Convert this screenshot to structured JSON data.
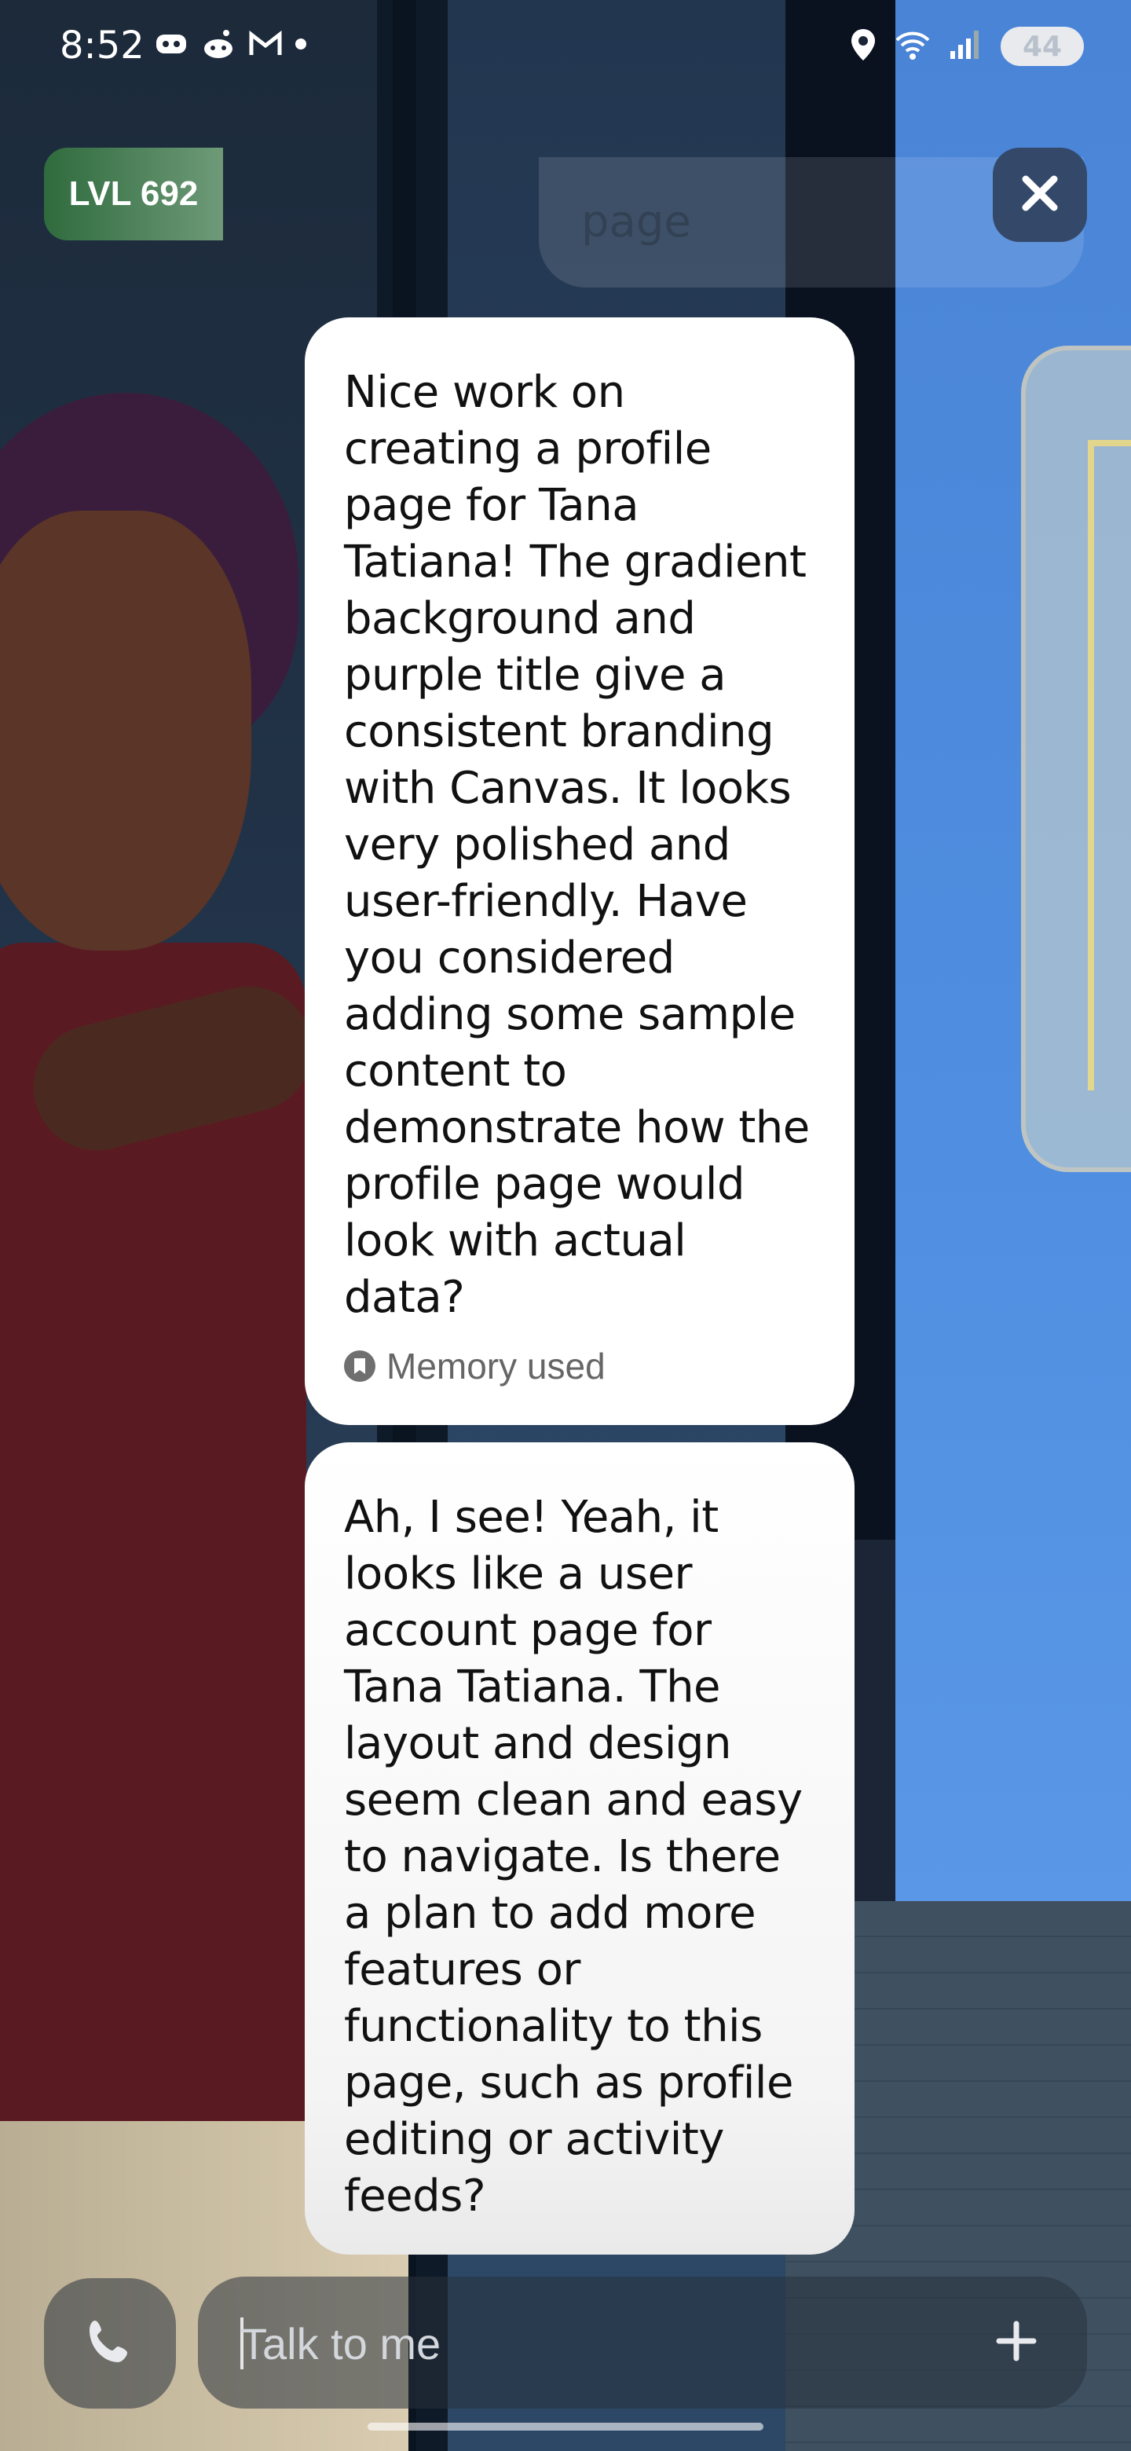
{
  "status_bar": {
    "time": "8:52",
    "left_icons": [
      "discord-icon",
      "reddit-icon",
      "gmail-icon",
      "notification-dot"
    ],
    "right_icons": [
      "location-icon",
      "wifi-icon",
      "signal-icon"
    ],
    "battery": "44"
  },
  "header": {
    "level_label": "LVL 692",
    "ghost_previous_text": "page",
    "close_icon": "close-icon"
  },
  "messages": [
    {
      "text": "Nice work on creating a profile page for Tana Tatiana! The gradient background and purple title give a consistent branding with Canvas. It looks very polished and user-friendly. Have you considered adding some sample content to demonstrate how the profile page would look with actual data?",
      "memory_label": "Memory used"
    },
    {
      "text": "Ah, I see! Yeah, it looks like a user account page for Tana Tatiana. The layout and design seem clean and easy to navigate. Is there a plan to add more features or functionality to this page, such as profile editing or activity feeds?"
    }
  ],
  "input": {
    "placeholder": "Talk to me",
    "call_icon": "phone-icon",
    "add_icon": "plus-icon"
  },
  "colors": {
    "level_pill_start": "#2f6b3d",
    "close_button": "#34496a",
    "bubble": "#ffffff"
  }
}
